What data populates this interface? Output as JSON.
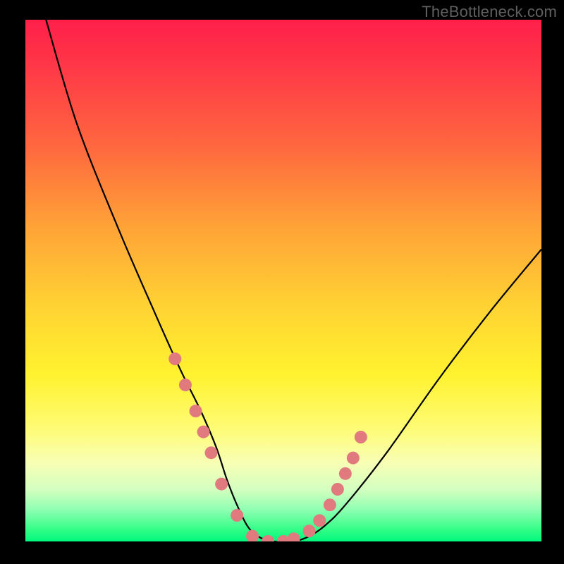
{
  "watermark": "TheBottleneck.com",
  "chart_data": {
    "type": "line",
    "title": "",
    "xlabel": "",
    "ylabel": "",
    "xlim": [
      0,
      100
    ],
    "ylim": [
      0,
      100
    ],
    "series": [
      {
        "name": "bottleneck-curve",
        "x": [
          4,
          10,
          18,
          25,
          30,
          34,
          37,
          39,
          41,
          43,
          45,
          48,
          52,
          55,
          58,
          62,
          70,
          80,
          90,
          100
        ],
        "values": [
          100,
          80,
          60,
          44,
          33,
          25,
          18,
          12,
          7,
          3,
          1,
          0,
          0,
          1,
          3,
          7,
          17,
          31,
          44,
          56
        ]
      }
    ],
    "markers": {
      "name": "sample-points",
      "x": [
        29,
        31,
        33,
        34.5,
        36,
        38,
        41,
        44,
        47,
        50,
        52,
        55,
        57,
        59,
        60.5,
        62,
        63.5,
        65
      ],
      "values": [
        35,
        30,
        25,
        21,
        17,
        11,
        5,
        1,
        0,
        0,
        0.5,
        2,
        4,
        7,
        10,
        13,
        16,
        20
      ],
      "color": "#e07a7e",
      "radius": 9
    }
  }
}
